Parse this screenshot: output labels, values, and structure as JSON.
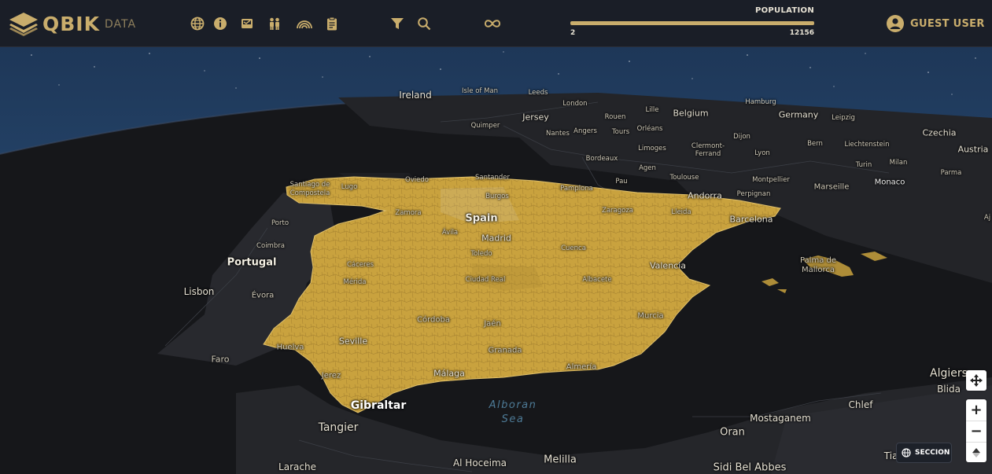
{
  "brand": {
    "name": "QBIK",
    "suffix": "DATA"
  },
  "toolbar": {
    "icons": [
      "globe-icon",
      "info-icon",
      "inbox-icon",
      "people-icon",
      "rainbow-icon",
      "clipboard-icon",
      "filter-icon",
      "search-icon",
      "infinity-icon"
    ]
  },
  "population": {
    "title": "POPULATION",
    "min": "2",
    "max": "12156"
  },
  "user": {
    "label": "GUEST USER"
  },
  "map": {
    "highlight_color": "#c9a23e",
    "labels": {
      "ireland": "Ireland",
      "isle_of_man": "Isle of Man",
      "leeds": "Leeds",
      "london": "London",
      "hamburg": "Hamburg",
      "lille": "Lille",
      "belgium": "Belgium",
      "germany": "Germany",
      "leipzig": "Leipzig",
      "jersey": "Jersey",
      "rouen": "Rouen",
      "quimper": "Quimper",
      "nantes": "Nantes",
      "angers": "Angers",
      "tours": "Tours",
      "orleans": "Orléans",
      "dijon": "Dijon",
      "czechia": "Czechia",
      "bern": "Bern",
      "liechtenstein": "Liechtenstein",
      "austria": "Austria",
      "limoges": "Limoges",
      "clermont": "Clermont-\nFerrand",
      "lyon": "Lyon",
      "turin": "Turin",
      "milan": "Milan",
      "bordeaux": "Bordeaux",
      "agen": "Agen",
      "parma": "Parma",
      "toulouse": "Toulouse",
      "montpellier": "Montpellier",
      "marseille": "Marseille",
      "monaco": "Monaco",
      "pau": "Pau",
      "andorra": "Andorra",
      "perpignan": "Perpignan",
      "santiago": "Santiago de\nCompostela",
      "lugo": "Lugo",
      "oviedo": "Oviedo",
      "santander": "Santander",
      "pamplona": "Pamplona",
      "burgos": "Burgos",
      "zamora": "Zamora",
      "spain": "Spain",
      "zaragoza": "Zaragoza",
      "lleida": "Lleida",
      "barcelona": "Barcelona",
      "porto": "Porto",
      "avila": "Ávila",
      "madrid": "Madrid",
      "coimbra": "Coimbra",
      "toledo": "Toledo",
      "cuenca": "Cuenca",
      "portugal": "Portugal",
      "caceres": "Cáceres",
      "palma": "Palma de\nMallorca",
      "valencia": "Valencia",
      "merida": "Mérida",
      "ciudad_real": "Ciudad Real",
      "albacete": "Albacete",
      "lisbon": "Lisbon",
      "evora": "Évora",
      "cordoba": "Córdoba",
      "jaen": "Jaén",
      "murcia": "Murcia",
      "huelva": "Huelva",
      "seville": "Seville",
      "granada": "Granada",
      "faro": "Faro",
      "almeria": "Almería",
      "jerez": "Jerez",
      "malaga": "Málaga",
      "gibraltar": "Gibraltar",
      "alboran": "Alboran\nSea",
      "tangier": "Tangier",
      "algiers": "Algiers",
      "blida": "Blida",
      "chlef": "Chlef",
      "mostaganem": "Mostaganem",
      "oran": "Oran",
      "al_hoceima": "Al Hoceima",
      "melilla": "Melilla",
      "larache": "Larache",
      "sidi_bel_abbes": "Sidi Bel Abbes",
      "tiaret": "Tiaret",
      "aj": "Aj"
    }
  },
  "controls": {
    "zoom_in": "+",
    "zoom_out": "−",
    "seccion": "SECCION"
  }
}
